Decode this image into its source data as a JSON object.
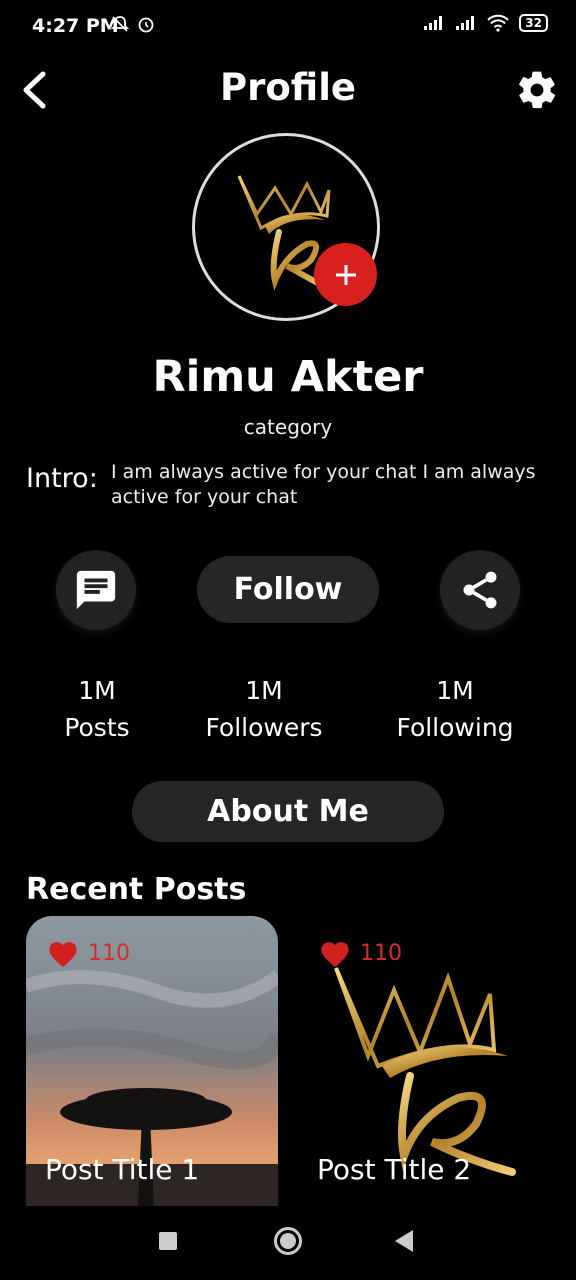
{
  "status_bar": {
    "time": "4:27 PM",
    "battery": "32"
  },
  "header": {
    "title": "Profile"
  },
  "profile": {
    "name": "Rimu Akter",
    "category": "category",
    "intro_label": "Intro:",
    "intro_text": "I am always active for your chat I am always active for your chat"
  },
  "actions": {
    "follow_label": "Follow"
  },
  "stats": [
    {
      "value": "1M",
      "label": "Posts"
    },
    {
      "value": "1M",
      "label": "Followers"
    },
    {
      "value": "1M",
      "label": "Following"
    }
  ],
  "about_label": "About Me",
  "recent_title": "Recent Posts",
  "posts": [
    {
      "likes": "110",
      "title": "Post Title 1"
    },
    {
      "likes": "110",
      "title": "Post Title 2"
    }
  ],
  "colors": {
    "accent_red": "#d8201f",
    "button_bg": "#262626",
    "gold": "#c9a44c"
  }
}
